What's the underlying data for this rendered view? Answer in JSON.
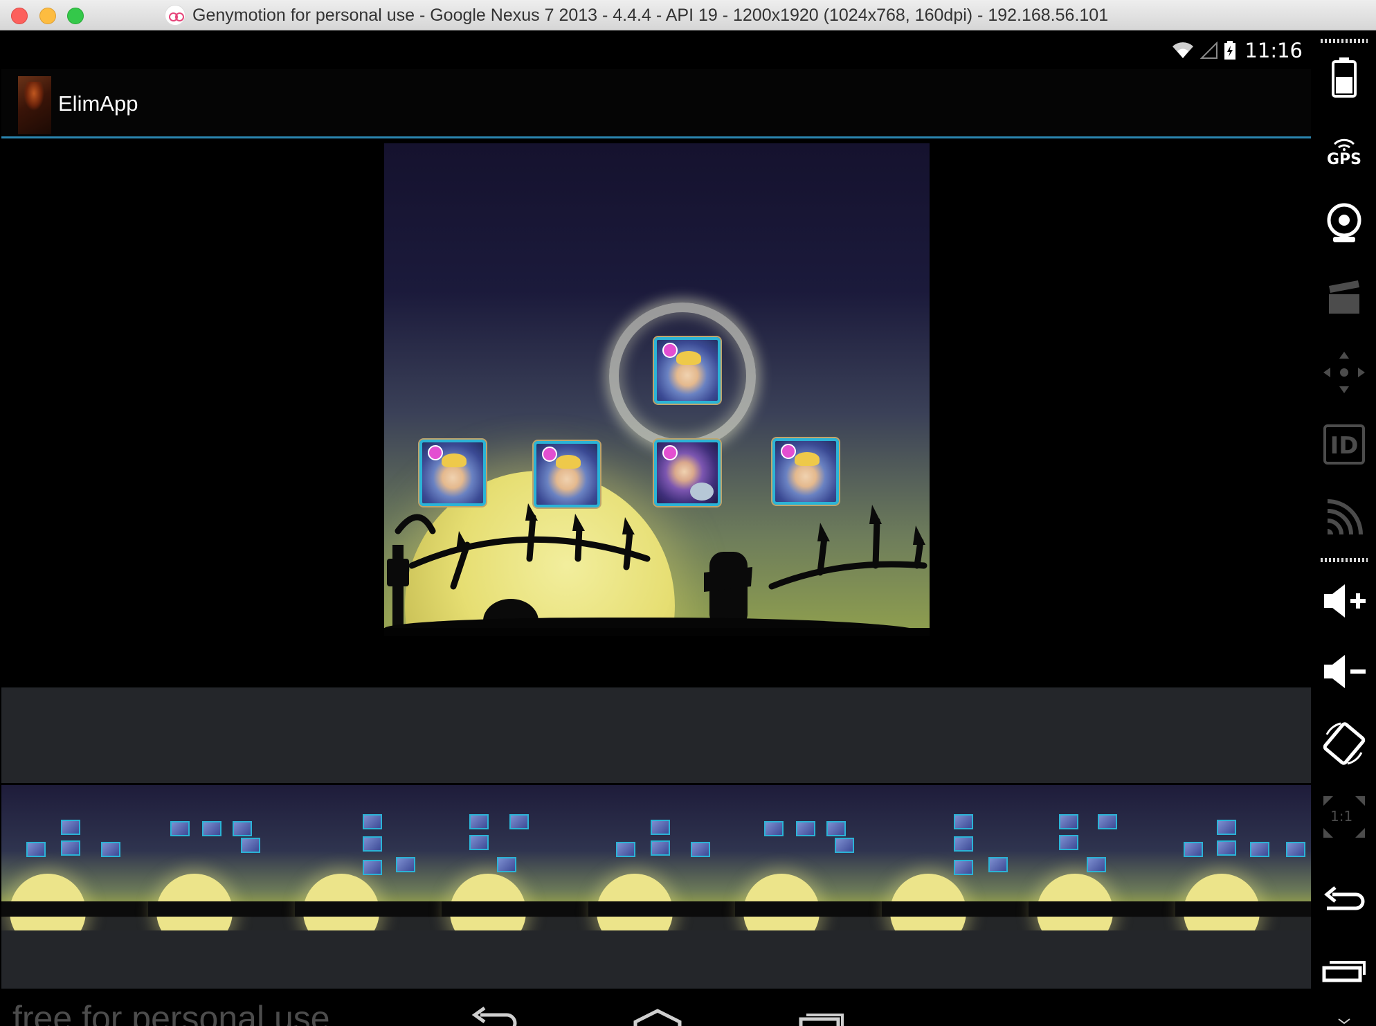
{
  "window": {
    "title": "Genymotion for personal use - Google Nexus 7 2013 - 4.4.4 - API 19 - 1200x1920 (1024x768, 160dpi) - 192.168.56.101"
  },
  "status_bar": {
    "time": "11:16",
    "icons": [
      "wifi-icon",
      "signal-icon",
      "battery-icon"
    ]
  },
  "action_bar": {
    "app_title": "ElimApp"
  },
  "game": {
    "heroes": [
      "hero-hooded-mage",
      "hero-hooded-mage",
      "hero-hooded-mage",
      "hero-cat-mage",
      "hero-hooded-mage"
    ],
    "swap_indicator": "swap-arrows"
  },
  "nav_bar": {
    "watermark": "free for personal use",
    "buttons": [
      "back",
      "home",
      "recent-apps"
    ]
  },
  "sidebar": {
    "gps_label": "GPS",
    "id_label": "ID",
    "pixel_perfect_label": "1:1",
    "buttons": [
      "battery",
      "gps",
      "camera",
      "media",
      "dpad",
      "identifiers",
      "cast",
      "volume-up",
      "volume-down",
      "rotate",
      "pixel-perfect",
      "back",
      "recent-apps"
    ]
  },
  "colors": {
    "actionbar_underline": "#2b86b1",
    "hero_border": "#2bb3d6",
    "moon": "#e6de72",
    "panel_gray": "#24262a"
  }
}
